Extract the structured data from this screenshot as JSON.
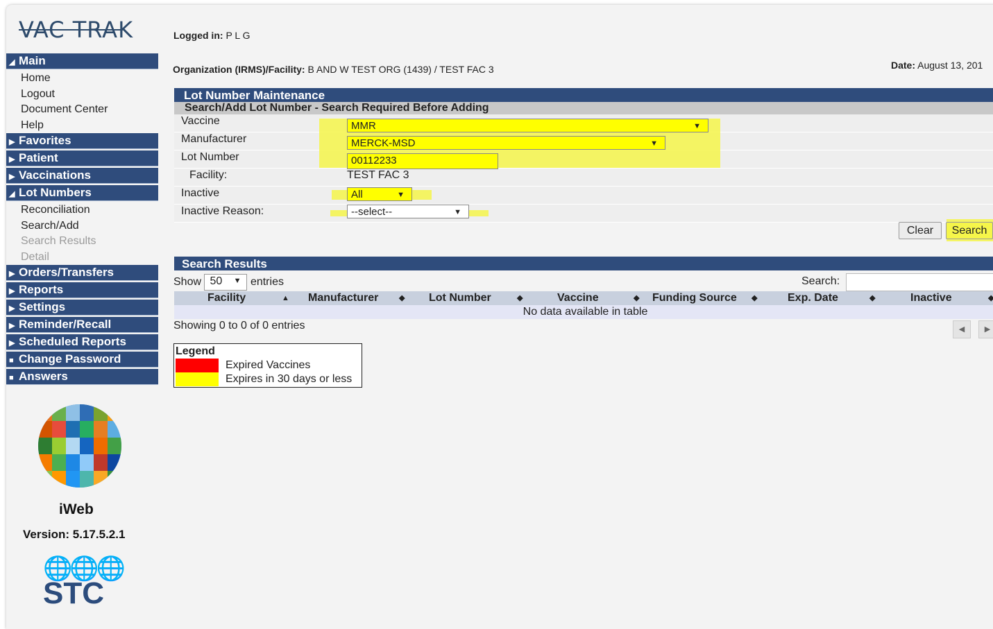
{
  "app": {
    "logo_text": "VAC TRAK"
  },
  "nav": {
    "main": {
      "label": "Main",
      "items": [
        "Home",
        "Logout",
        "Document Center",
        "Help"
      ]
    },
    "favorites": "Favorites",
    "patient": "Patient",
    "vaccinations": "Vaccinations",
    "lot_numbers": {
      "label": "Lot Numbers",
      "items": [
        "Reconciliation",
        "Search/Add",
        "Search Results",
        "Detail"
      ]
    },
    "orders_transfers": "Orders/Transfers",
    "reports": "Reports",
    "settings": "Settings",
    "reminder_recall": "Reminder/Recall",
    "scheduled_reports": "Scheduled Reports",
    "change_password": "Change Password",
    "answers": "Answers"
  },
  "brand": {
    "iweb": "iWeb",
    "version": "Version: 5.17.5.2.1",
    "stc": "STC"
  },
  "header": {
    "logged_in_label": "Logged in:",
    "logged_in_value": "P L G",
    "org_label": "Organization (IRMS)/Facility:",
    "org_value": "B AND W TEST ORG (1439) / TEST FAC 3",
    "date_label": "Date:",
    "date_value": "August 13, 201"
  },
  "form": {
    "title": "Lot Number Maintenance",
    "subtitle": "Search/Add Lot Number - Search Required Before Adding",
    "vaccine_label": "Vaccine",
    "vaccine_value": "MMR",
    "manufacturer_label": "Manufacturer",
    "manufacturer_value": "MERCK-MSD",
    "lot_label": "Lot Number",
    "lot_value": "00112233",
    "facility_label": "Facility:",
    "facility_value": "TEST FAC 3",
    "inactive_label": "Inactive",
    "inactive_value": "All",
    "inactive_reason_label": "Inactive Reason:",
    "inactive_reason_value": "--select--",
    "clear_label": "Clear",
    "search_label": "Search"
  },
  "results": {
    "title": "Search Results",
    "show_label": "Show",
    "show_value": "50",
    "entries_label": "entries",
    "search_label": "Search:",
    "columns": [
      "Facility",
      "Manufacturer",
      "Lot Number",
      "Vaccine",
      "Funding Source",
      "Exp. Date",
      "Inactive"
    ],
    "no_data": "No data available in table",
    "info": "Showing 0 to 0 of 0 entries"
  },
  "legend": {
    "title": "Legend",
    "expired": "Expired Vaccines",
    "expiring": "Expires in 30 days or less",
    "expired_color": "#ff0000",
    "expiring_color": "#ffff00"
  }
}
